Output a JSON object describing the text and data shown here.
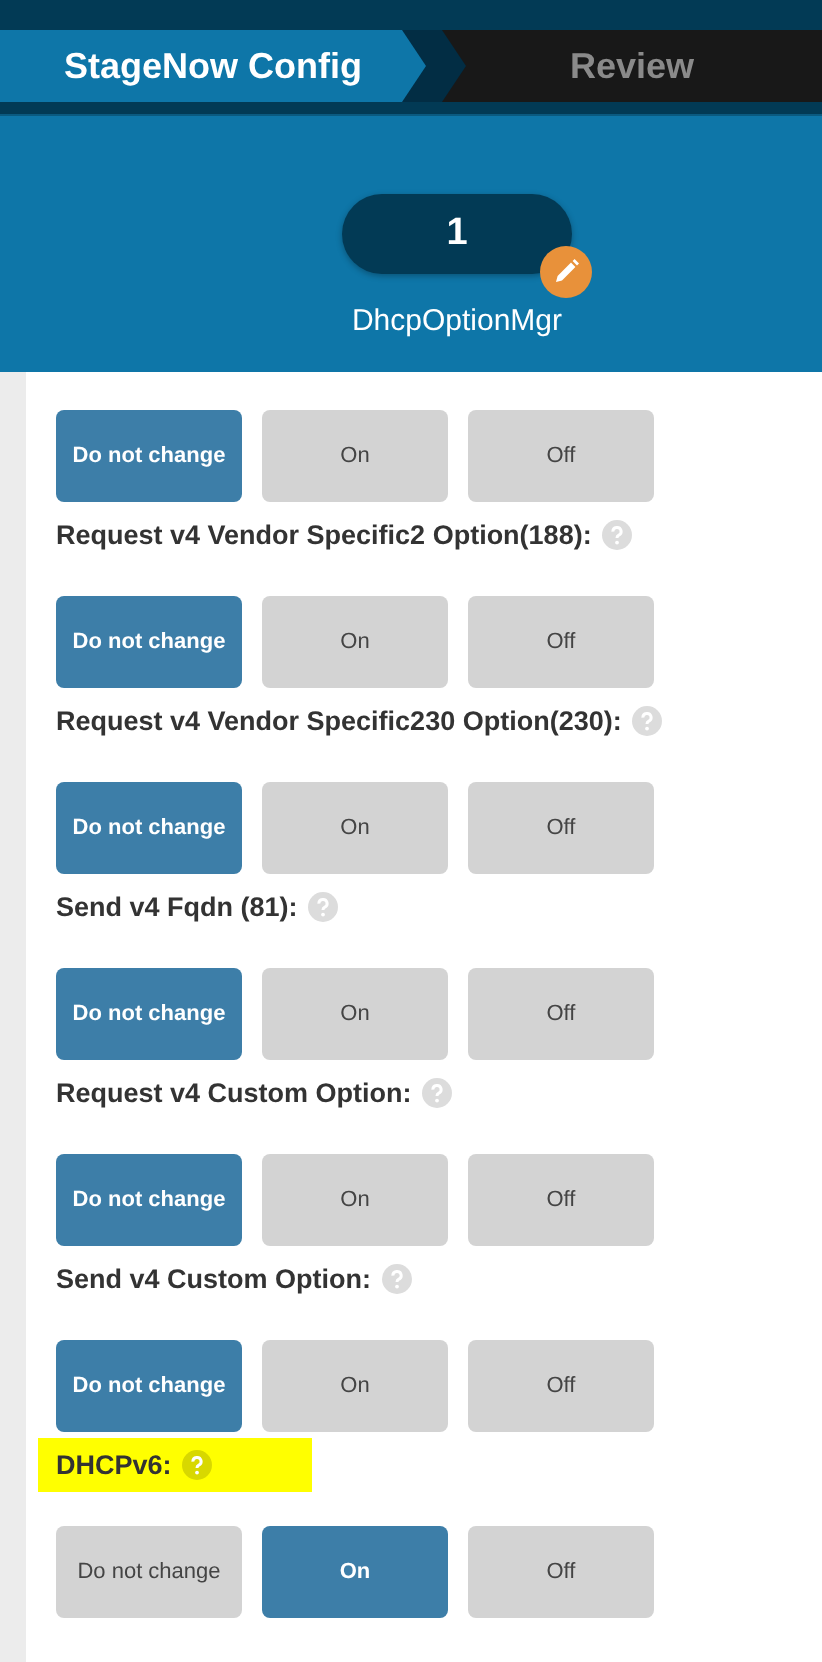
{
  "steps": [
    {
      "label": "StageNow Config",
      "selected": true
    },
    {
      "label": "Review",
      "selected": false
    }
  ],
  "module": {
    "count": "1",
    "name": "DhcpOptionMgr"
  },
  "groups": [
    {
      "options": [
        {
          "label": "Do not change",
          "selected": true
        },
        {
          "label": "On",
          "selected": false
        },
        {
          "label": "Off",
          "selected": false
        }
      ]
    },
    {
      "label": "Request v4 Vendor Specific2 Option(188):",
      "highlighted": false,
      "options": [
        {
          "label": "Do not change",
          "selected": true
        },
        {
          "label": "On",
          "selected": false
        },
        {
          "label": "Off",
          "selected": false
        }
      ]
    },
    {
      "label": "Request v4 Vendor Specific230 Option(230):",
      "highlighted": false,
      "options": [
        {
          "label": "Do not change",
          "selected": true
        },
        {
          "label": "On",
          "selected": false
        },
        {
          "label": "Off",
          "selected": false
        }
      ]
    },
    {
      "label": "Send v4 Fqdn (81):",
      "highlighted": false,
      "options": [
        {
          "label": "Do not change",
          "selected": true
        },
        {
          "label": "On",
          "selected": false
        },
        {
          "label": "Off",
          "selected": false
        }
      ]
    },
    {
      "label": "Request v4 Custom Option:",
      "highlighted": false,
      "options": [
        {
          "label": "Do not change",
          "selected": true
        },
        {
          "label": "On",
          "selected": false
        },
        {
          "label": "Off",
          "selected": false
        }
      ]
    },
    {
      "label": "Send v4 Custom Option:",
      "highlighted": false,
      "options": [
        {
          "label": "Do not change",
          "selected": true
        },
        {
          "label": "On",
          "selected": false
        },
        {
          "label": "Off",
          "selected": false
        }
      ]
    },
    {
      "label": "DHCPv6:",
      "highlighted": true,
      "options": [
        {
          "label": "Do not change",
          "selected": false
        },
        {
          "label": "On",
          "selected": true
        },
        {
          "label": "Off",
          "selected": false
        }
      ]
    }
  ]
}
